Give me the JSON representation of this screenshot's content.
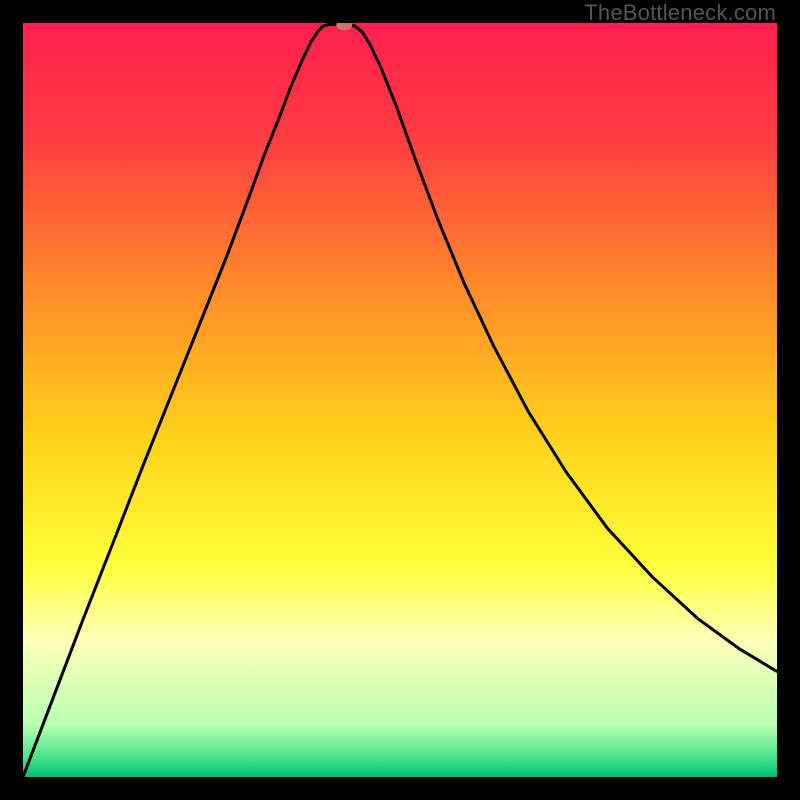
{
  "watermark": "TheBottleneck.com",
  "chart_data": {
    "type": "line",
    "title": "",
    "xlabel": "",
    "ylabel": "",
    "xlim": [
      0,
      1
    ],
    "ylim": [
      0,
      1
    ],
    "background_gradient": [
      {
        "stop": 0.0,
        "color": "#ff1f4f"
      },
      {
        "stop": 0.15,
        "color": "#ff3b42"
      },
      {
        "stop": 0.35,
        "color": "#ff8a2a"
      },
      {
        "stop": 0.55,
        "color": "#ffd21a"
      },
      {
        "stop": 0.72,
        "color": "#ffff3a"
      },
      {
        "stop": 0.82,
        "color": "#fdffb8"
      },
      {
        "stop": 0.93,
        "color": "#b9ffb2"
      },
      {
        "stop": 0.975,
        "color": "#46e38a"
      },
      {
        "stop": 1.0,
        "color": "#00c074"
      }
    ],
    "curve": [
      {
        "x": 0.0,
        "y": 0.0
      },
      {
        "x": 0.04,
        "y": 0.105
      },
      {
        "x": 0.08,
        "y": 0.21
      },
      {
        "x": 0.12,
        "y": 0.312
      },
      {
        "x": 0.16,
        "y": 0.415
      },
      {
        "x": 0.2,
        "y": 0.515
      },
      {
        "x": 0.24,
        "y": 0.615
      },
      {
        "x": 0.27,
        "y": 0.69
      },
      {
        "x": 0.3,
        "y": 0.77
      },
      {
        "x": 0.32,
        "y": 0.825
      },
      {
        "x": 0.34,
        "y": 0.875
      },
      {
        "x": 0.355,
        "y": 0.915
      },
      {
        "x": 0.37,
        "y": 0.95
      },
      {
        "x": 0.382,
        "y": 0.975
      },
      {
        "x": 0.392,
        "y": 0.99
      },
      {
        "x": 0.398,
        "y": 0.996
      },
      {
        "x": 0.405,
        "y": 0.998
      },
      {
        "x": 0.418,
        "y": 0.998
      },
      {
        "x": 0.43,
        "y": 0.998
      },
      {
        "x": 0.44,
        "y": 0.996
      },
      {
        "x": 0.45,
        "y": 0.988
      },
      {
        "x": 0.46,
        "y": 0.972
      },
      {
        "x": 0.475,
        "y": 0.94
      },
      {
        "x": 0.495,
        "y": 0.89
      },
      {
        "x": 0.52,
        "y": 0.82
      },
      {
        "x": 0.55,
        "y": 0.74
      },
      {
        "x": 0.585,
        "y": 0.655
      },
      {
        "x": 0.625,
        "y": 0.57
      },
      {
        "x": 0.67,
        "y": 0.485
      },
      {
        "x": 0.72,
        "y": 0.405
      },
      {
        "x": 0.775,
        "y": 0.33
      },
      {
        "x": 0.835,
        "y": 0.265
      },
      {
        "x": 0.895,
        "y": 0.21
      },
      {
        "x": 0.95,
        "y": 0.17
      },
      {
        "x": 1.0,
        "y": 0.14
      }
    ],
    "marker": {
      "x": 0.426,
      "y": 0.997,
      "color": "#c9766b",
      "rx": 8,
      "ry": 5
    }
  }
}
